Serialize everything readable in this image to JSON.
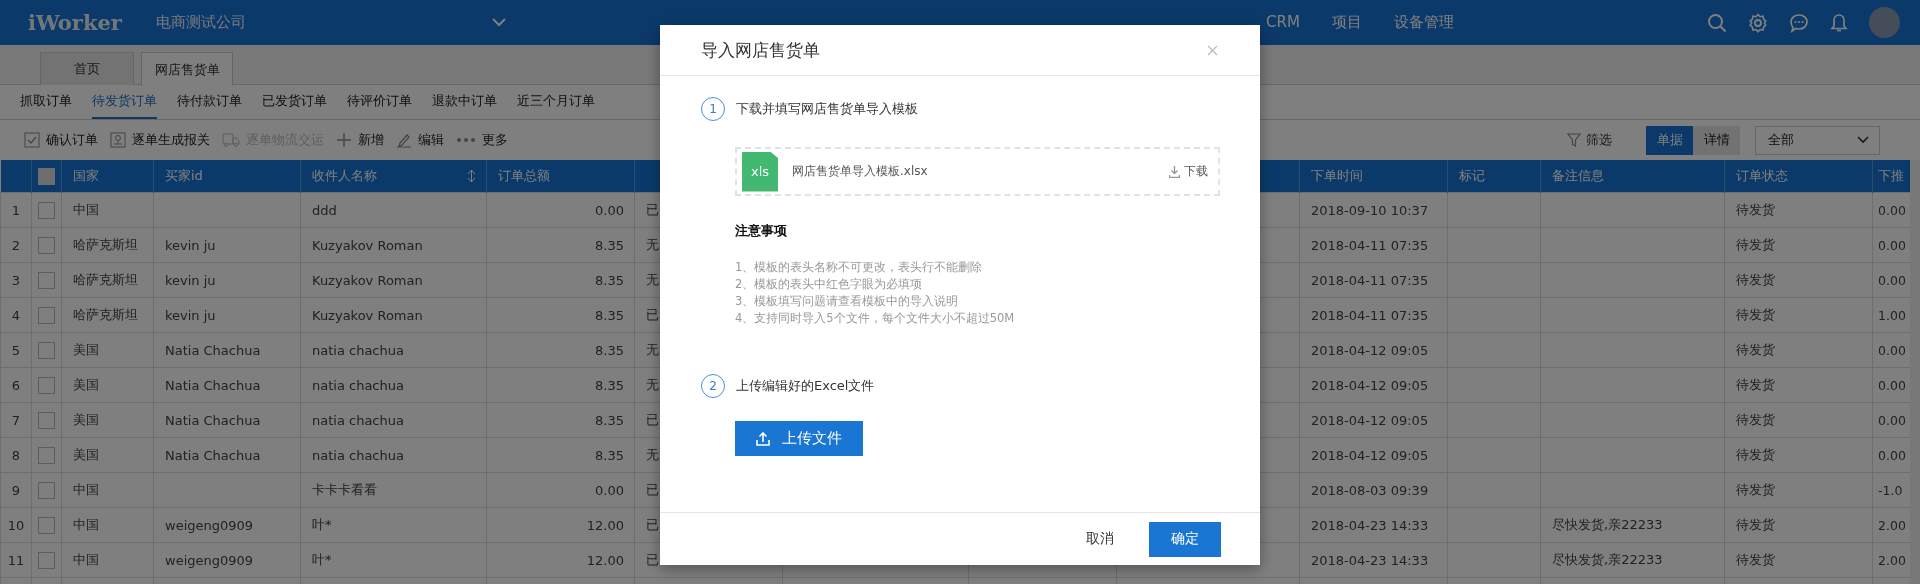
{
  "header": {
    "logo": "iWorker",
    "company": "电商测试公司",
    "nav": [
      "CRM",
      "项目",
      "设备管理"
    ]
  },
  "page_tabs": [
    {
      "label": "首页",
      "selected": false
    },
    {
      "label": "网店售货单",
      "selected": true
    }
  ],
  "order_tabs": [
    {
      "label": "抓取订单",
      "selected": false
    },
    {
      "label": "待发货订单",
      "selected": true
    },
    {
      "label": "待付款订单",
      "selected": false
    },
    {
      "label": "已发货订单",
      "selected": false
    },
    {
      "label": "待评价订单",
      "selected": false
    },
    {
      "label": "退款中订单",
      "selected": false
    },
    {
      "label": "近三个月订单",
      "selected": false
    }
  ],
  "toolbar": {
    "actions": [
      {
        "kind": "confirm",
        "label": "确认订单",
        "disabled": false
      },
      {
        "kind": "customs",
        "label": "逐单生成报关",
        "disabled": false
      },
      {
        "kind": "shipping",
        "label": "逐单物流交运",
        "disabled": true
      },
      {
        "kind": "add",
        "label": "新增",
        "disabled": false
      },
      {
        "kind": "edit",
        "label": "编辑",
        "disabled": false
      },
      {
        "kind": "more",
        "label": "更多",
        "disabled": false
      }
    ],
    "filter": "筛选",
    "view_modes": [
      {
        "label": "单据",
        "selected": true
      },
      {
        "label": "详情",
        "selected": false
      }
    ],
    "scope_select": "全部"
  },
  "table": {
    "columns": {
      "country": "国家",
      "buyer_id": "买家id",
      "recipient": "收件人名称",
      "total": "订单总额",
      "order_time": "下单时间",
      "mark": "标记",
      "note": "备注信息",
      "status": "订单状态",
      "column_15": "下推"
    },
    "select_all_checked": false,
    "rows": [
      {
        "no": "1",
        "checked": false,
        "country": "中国",
        "recipient": "ddd",
        "total": "0.00",
        "column_5": "已",
        "order_time": "2018-09-10 10:37",
        "status": "待发货",
        "column_15": "0.00"
      },
      {
        "no": "2",
        "checked": false,
        "country": "哈萨克斯坦",
        "buyer_id": "kevin ju",
        "recipient": "Kuzyakov Roman",
        "total": "8.35",
        "column_5": "无",
        "order_time": "2018-04-11 07:35",
        "status": "待发货",
        "column_15": "0.00"
      },
      {
        "no": "3",
        "checked": false,
        "country": "哈萨克斯坦",
        "buyer_id": "kevin ju",
        "recipient": "Kuzyakov Roman",
        "total": "8.35",
        "column_5": "无",
        "order_time": "2018-04-11 07:35",
        "status": "待发货",
        "column_15": "0.00"
      },
      {
        "no": "4",
        "checked": false,
        "country": "哈萨克斯坦",
        "buyer_id": "kevin ju",
        "recipient": "Kuzyakov Roman",
        "total": "8.35",
        "column_5": "已",
        "order_time": "2018-04-11 07:35",
        "status": "待发货",
        "column_15": "1.00"
      },
      {
        "no": "5",
        "checked": false,
        "country": "美国",
        "buyer_id": "Natia Chachua",
        "recipient": "natia chachua",
        "total": "8.35",
        "column_5": "无",
        "order_time": "2018-04-12 09:05",
        "status": "待发货",
        "column_15": "0.00"
      },
      {
        "no": "6",
        "checked": false,
        "country": "美国",
        "buyer_id": "Natia Chachua",
        "recipient": "natia chachua",
        "total": "8.35",
        "column_5": "无",
        "order_time": "2018-04-12 09:05",
        "status": "待发货",
        "column_15": "0.00"
      },
      {
        "no": "7",
        "checked": false,
        "country": "美国",
        "buyer_id": "Natia Chachua",
        "recipient": "natia chachua",
        "total": "8.35",
        "column_5": "已",
        "order_time": "2018-04-12 09:05",
        "status": "待发货",
        "column_15": "0.00"
      },
      {
        "no": "8",
        "checked": false,
        "country": "美国",
        "buyer_id": "Natia Chachua",
        "recipient": "natia chachua",
        "total": "8.35",
        "column_5": "无",
        "order_time": "2018-04-12 09:05",
        "status": "待发货",
        "column_15": "0.00"
      },
      {
        "no": "9",
        "checked": false,
        "country": "中国",
        "recipient": "卡卡卡看看",
        "total": "0.00",
        "column_5": "已",
        "order_time": "2018-08-03 09:39",
        "status": "待发货",
        "column_15": "-1.0"
      },
      {
        "no": "10",
        "checked": false,
        "country": "中国",
        "buyer_id": "weigeng0909",
        "recipient": "叶*",
        "total": "12.00",
        "column_5": "已",
        "order_time": "2018-04-23 14:33",
        "note": "尽快发货,亲22233",
        "status": "待发货",
        "column_15": "2.00"
      },
      {
        "no": "11",
        "checked": false,
        "country": "中国",
        "buyer_id": "weigeng0909",
        "recipient": "叶*",
        "total": "12.00",
        "column_5": "已",
        "order_time": "2018-04-23 14:33",
        "note": "尽快发货,亲22233",
        "status": "待发货",
        "column_15": "2.00"
      }
    ]
  },
  "dialog": {
    "title": "导入网店售货单",
    "steps": [
      {
        "number": "1",
        "label": "下载并填写网店售货单导入模板"
      },
      {
        "number": "2",
        "label": "上传编辑好的Excel文件"
      }
    ],
    "template": {
      "badge": "xls",
      "file_name": "网店售货单导入模板.xlsx",
      "download": "下载"
    },
    "notes_title": "注意事项",
    "notes": [
      "1、模板的表头名称不可更改，表头行不能删除",
      "2、模板的表头中红色字眼为必填项",
      "3、模板填写问题请查看模板中的导入说明",
      "4、支持同时导入5个文件，每个文件大小不超过50M"
    ],
    "upload_button": "上传文件",
    "cancel": "取消",
    "confirm": "确定"
  }
}
